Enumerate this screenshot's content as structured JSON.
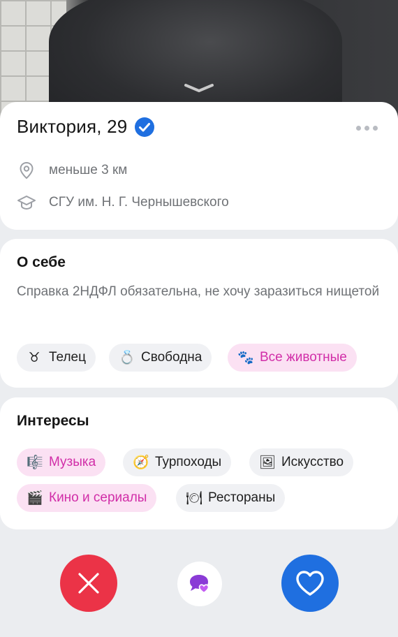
{
  "profile": {
    "name_age": "Виктория, 29",
    "distance": "меньше 3 км",
    "education": "СГУ им. Н. Г. Чернышевского"
  },
  "about": {
    "title": "О себе",
    "text": "Справка 2НДФЛ обязательна, не хочу заразиться нищетой",
    "tags": [
      {
        "emoji": "♉",
        "label": "Телец"
      },
      {
        "emoji": "💍",
        "label": "Свободна"
      },
      {
        "emoji": "🐾",
        "label": "Все животные"
      }
    ]
  },
  "interests": {
    "title": "Интересы",
    "items": [
      {
        "emoji": "🎼",
        "label": "Музыка"
      },
      {
        "emoji": "🧭",
        "label": "Турпоходы"
      },
      {
        "emoji": "🖼",
        "label": "Искусство"
      },
      {
        "emoji": "🎬",
        "label": "Кино и сериалы"
      },
      {
        "emoji": "🍽",
        "label": "Рестораны"
      }
    ]
  },
  "icons": {
    "verified": "verified-badge-icon",
    "more": "more-dots-icon",
    "location": "location-pin-icon",
    "education": "graduation-cap-icon",
    "dislike": "close-icon",
    "message": "chat-heart-icon",
    "like": "heart-icon"
  },
  "colors": {
    "accent_blue": "#1f6fe0",
    "dislike_red": "#eb3347",
    "pink_chip_bg": "#fbe1f3",
    "pink_chip_text": "#d12ea8",
    "message_purple": "#8a3bd6"
  }
}
